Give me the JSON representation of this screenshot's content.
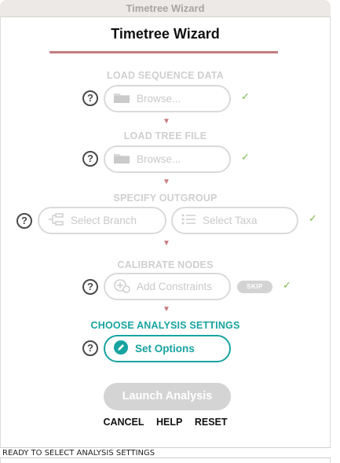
{
  "window": {
    "title": "Timetree Wizard"
  },
  "heading": "Timetree Wizard",
  "steps": {
    "load_sequence": {
      "label": "LOAD SEQUENCE DATA",
      "button": "Browse...",
      "done": "✓"
    },
    "load_tree": {
      "label": "LOAD TREE FILE",
      "button": "Browse...",
      "done": "✓"
    },
    "outgroup": {
      "label": "SPECIFY OUTGROUP",
      "branch_button": "Select Branch",
      "taxa_button": "Select Taxa",
      "done": "✓"
    },
    "calibrate": {
      "label": "CALIBRATE NODES",
      "button": "Add Constraints",
      "skip": "SKIP",
      "done": "✓"
    },
    "analysis": {
      "label": "CHOOSE ANALYSIS SETTINGS",
      "button": "Set Options"
    }
  },
  "help_glyph": "?",
  "arrow_glyph": "▼",
  "launch_button": "Launch Analysis",
  "links": {
    "cancel": "CANCEL",
    "help": "HELP",
    "reset": "RESET"
  },
  "status": "READY TO SELECT ANALYSIS SETTINGS",
  "colors": {
    "accent": "#17a3a0",
    "rule": "#c47c80",
    "check": "#7dbb4f",
    "disabled": "#cfcfcf"
  }
}
